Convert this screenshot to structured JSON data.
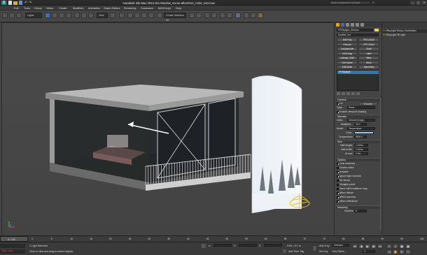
{
  "titlebar": {
    "logo": "3",
    "title": "Autodesk 3ds Max 2013 x64    Window_scene-after2013_Color_test.max",
    "search_placeholder": "Type a keyword or phrase",
    "min": "—",
    "max": "▢",
    "close": "✕"
  },
  "menubar": {
    "items": [
      "Edit",
      "Tools",
      "Group",
      "Views",
      "Create",
      "Modifiers",
      "Animation",
      "Graph Editors",
      "Rendering",
      "Customize",
      "MAXScript",
      "Help"
    ]
  },
  "toolbar": {
    "selection_filter": "Lights",
    "view_label": "View",
    "create_selection": "Create Selection Se"
  },
  "viewport": {
    "label": "[ + ] [ Perspective ] [ Smooth + Highlights ]"
  },
  "command_panel": {
    "object_name": "PRSkylight_Window",
    "modifier_list": "Modifier List",
    "buttons": [
      "Edit Poly",
      "FFD 2x2x2",
      "Extrude",
      "FFD 3x3x3",
      "Turbosmooth",
      "Shell",
      "UVW Map",
      "Lathe",
      "Unwrap UVW",
      "Slice",
      "Edit Spline",
      "Bend",
      "Edit Mesh",
      "Symmetry"
    ],
    "stack_item": "PRSkylight",
    "general": {
      "title": "General",
      "on_label": "On",
      "exclude_label": "Exclude",
      "type_label": "Type:",
      "type_value": "Plane",
      "viewport_shading": "Enable viewport shading"
    },
    "intensity": {
      "title": "Intensity",
      "units_label": "Units:",
      "units_value": "Default (image)",
      "multiplier_label": "Multiplier:",
      "multiplier_value": "30.0",
      "mode_label": "Mode:",
      "mode_value": "Temperature",
      "color_label": "Color:",
      "temperature_label": "Temperature:",
      "temperature_value": "6500.0"
    },
    "size": {
      "title": "Size",
      "half_length_label": "Half-length:",
      "half_length_value": "1.524m",
      "half_width_label": "Half-width:",
      "half_width_value": "1.524m",
      "w_size_label": "W size:",
      "w_size_value": "0.0m"
    },
    "options": {
      "title": "Options",
      "items": [
        {
          "label": "Cast shadows",
          "on": true
        },
        {
          "label": "Double-sided",
          "on": false
        },
        {
          "label": "Invisible",
          "on": true
        },
        {
          "label": "Ignore light normals",
          "on": true
        },
        {
          "label": "No decay",
          "on": false
        },
        {
          "label": "Skylight portal",
          "on": false
        },
        {
          "label": "Store with irradiance map",
          "on": false
        },
        {
          "label": "Affect diffuse",
          "on": true
        },
        {
          "label": "Affect specular",
          "on": true
        },
        {
          "label": "Affect reflections",
          "on": true
        }
      ]
    },
    "sampling": {
      "title": "Sampling",
      "subdivs_label": "Subdivs:",
      "subdivs_value": "8"
    }
  },
  "scene_explorer": {
    "items": [
      "VRayLight Setup ( Illumination",
      "VRayLight Fill Light"
    ]
  },
  "timeline": {
    "frame": "0 / 100",
    "ticks": [
      "0",
      "5",
      "10",
      "15",
      "20",
      "25",
      "30",
      "35",
      "40",
      "45",
      "50",
      "55",
      "60",
      "65",
      "70",
      "75",
      "80",
      "85",
      "90",
      "95",
      "100"
    ]
  },
  "statusbar": {
    "maxscript_hint": "Type: xxxx",
    "status": "1 Light Selected",
    "prompt": "Click or click-and-drag to select objects",
    "x_label": "X:",
    "y_label": "Y:",
    "z_label": "Z:",
    "grid": "Grid = 0.1 m",
    "add_time_tag": "Add Time Tag",
    "auto_key": "Auto Key",
    "set_key": "Set Key",
    "key_filters": "Key Filters...",
    "selected": "Selected",
    "frame_value": "0"
  },
  "colors": {
    "accent": "#1f8a8a",
    "temperature_swatch": "#9ec8e8",
    "selected_item": "#3a72b0"
  }
}
